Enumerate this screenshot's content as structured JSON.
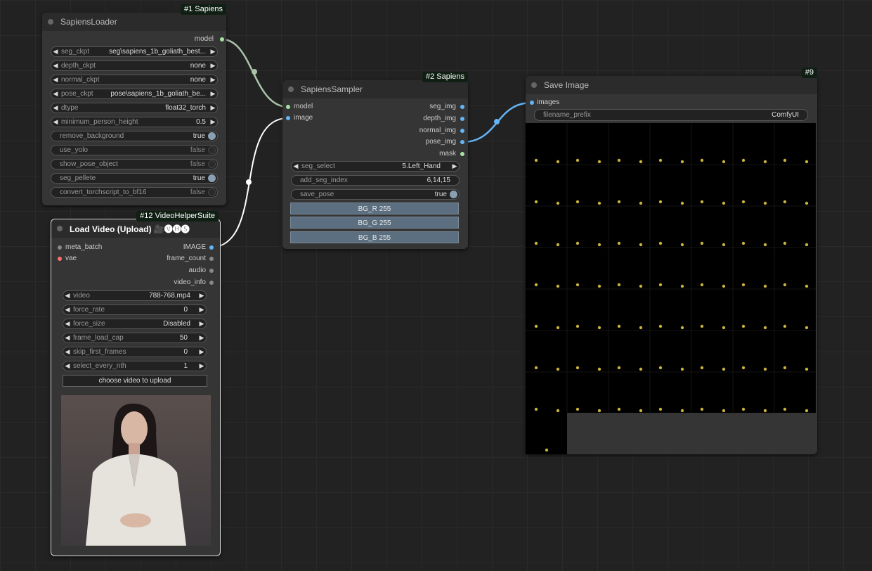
{
  "nodes": {
    "loader": {
      "badge": "#1 Sapiens",
      "title": "SapiensLoader",
      "output": "model",
      "widgets": [
        {
          "label": "seg_ckpt",
          "value": "seg\\sapiens_1b_goliath_best..."
        },
        {
          "label": "depth_ckpt",
          "value": "none"
        },
        {
          "label": "normal_ckpt",
          "value": "none"
        },
        {
          "label": "pose_ckpt",
          "value": "pose\\sapiens_1b_goliath_be..."
        },
        {
          "label": "dtype",
          "value": "float32_torch"
        },
        {
          "label": "minimum_person_height",
          "value": "0.5"
        },
        {
          "label": "remove_background",
          "value": "true"
        },
        {
          "label": "use_yolo",
          "value": "false"
        },
        {
          "label": "show_pose_object",
          "value": "false"
        },
        {
          "label": "seg_pellete",
          "value": "true"
        },
        {
          "label": "convert_torchscript_to_bf16",
          "value": "false"
        }
      ]
    },
    "sampler": {
      "badge": "#2 Sapiens",
      "title": "SapiensSampler",
      "inputs": [
        "model",
        "image"
      ],
      "outputs": [
        "seg_img",
        "depth_img",
        "normal_img",
        "pose_img",
        "mask"
      ],
      "widgets": [
        {
          "label": "seg_select",
          "value": "5.Left_Hand"
        },
        {
          "label": "add_seg_index",
          "value": "6,14,15"
        },
        {
          "label": "save_pose",
          "value": "true"
        }
      ],
      "buttons": [
        "BG_R  255",
        "BG_G  255",
        "BG_B  255"
      ]
    },
    "save": {
      "badge": "#9",
      "title": "Save Image",
      "input": "images",
      "widget": {
        "label": "filename_prefix",
        "value": "ComfyUI"
      }
    },
    "video": {
      "badge": "#12 VideoHelperSuite",
      "title": "Load Video (Upload) 🎥🅥🅗🅢",
      "inputs": [
        "meta_batch",
        "vae"
      ],
      "outputs": [
        "IMAGE",
        "frame_count",
        "audio",
        "video_info"
      ],
      "widgets": [
        {
          "label": "video",
          "value": "788-768.mp4"
        },
        {
          "label": "force_rate",
          "value": "0"
        },
        {
          "label": "force_size",
          "value": "Disabled"
        },
        {
          "label": "frame_load_cap",
          "value": "50"
        },
        {
          "label": "skip_first_frames",
          "value": "0"
        },
        {
          "label": "select_every_nth",
          "value": "1"
        }
      ],
      "upload_button": "choose video to upload"
    }
  },
  "colors": {
    "canvas": "#222222",
    "node": "#353535",
    "model_link": "#a9c3a8",
    "image_link": "#ffffff",
    "pose_link": "#64b5f6",
    "slot_model": "#a6e3a1",
    "slot_image": "#64b5f6",
    "slot_vae": "#ff7070"
  }
}
